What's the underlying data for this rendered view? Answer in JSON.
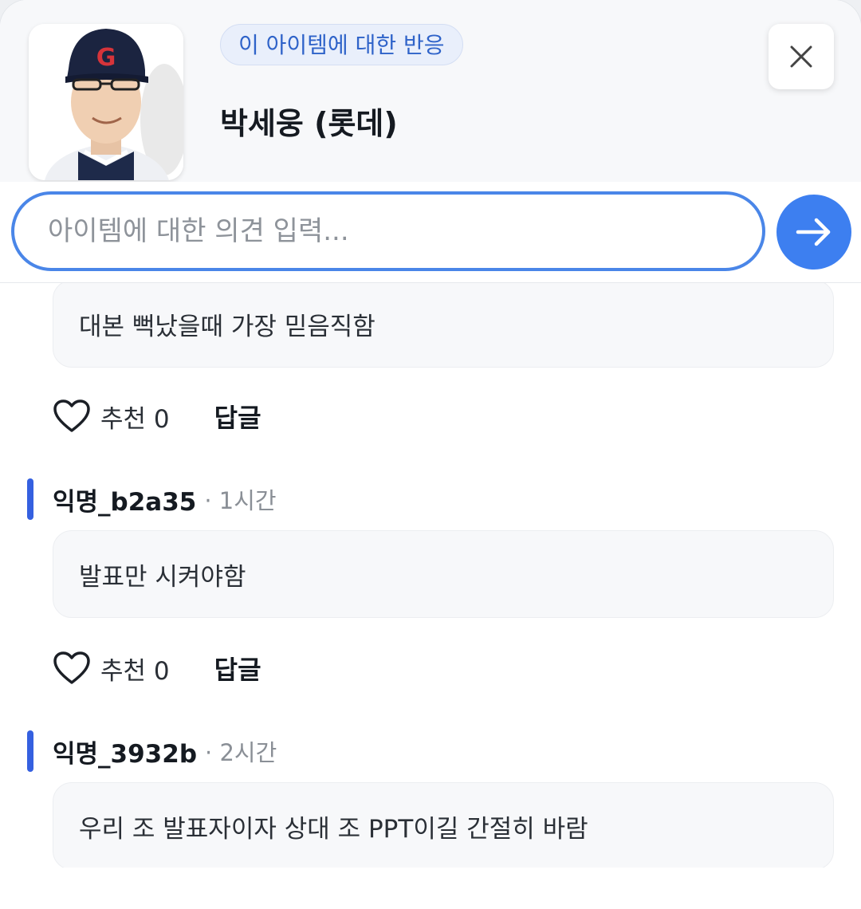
{
  "header": {
    "reaction_chip": "이 아이템에 대한 반응",
    "item_name": "박세웅 (롯데)",
    "cap_logo_letter": "G"
  },
  "composer": {
    "placeholder": "아이템에 대한 의견 입력..."
  },
  "comments": [
    {
      "author": "",
      "time": "",
      "text": "대본 뻑났을때 가장 믿음직함",
      "like_label": "추천 0",
      "reply_label": "답글"
    },
    {
      "author": "익명_b2a35",
      "time": "· 1시간",
      "text": "발표만 시켜야함",
      "like_label": "추천 0",
      "reply_label": "답글"
    },
    {
      "author": "익명_3932b",
      "time": "· 2시간",
      "text": "우리 조 발표자이자 상대 조 PPT이길 간절히 바람",
      "like_label": "",
      "reply_label": ""
    }
  ],
  "colors": {
    "accent": "#3d7ff0",
    "input_border": "#4a86e8",
    "author_bar": "#3560e0",
    "chip_text": "#2f63c9"
  },
  "icons": [
    "close-icon",
    "send-arrow-icon",
    "heart-icon"
  ]
}
